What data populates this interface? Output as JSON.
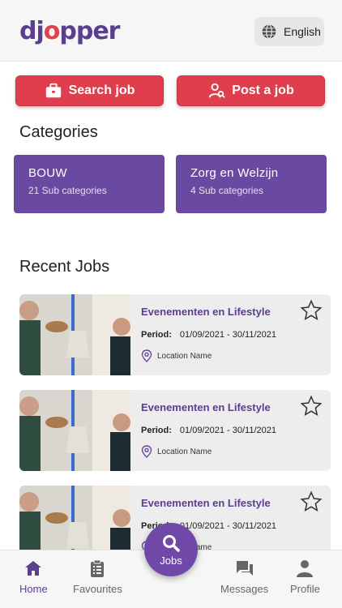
{
  "header": {
    "logo_text": "djopper",
    "language_label": "English"
  },
  "actions": {
    "search_job": "Search job",
    "post_job": "Post a job"
  },
  "categories": {
    "title": "Categories",
    "items": [
      {
        "name": "BOUW",
        "sub": "21 Sub categories"
      },
      {
        "name": "Zorg en Welzijn",
        "sub": "4 Sub categories"
      }
    ]
  },
  "recent_jobs": {
    "title": "Recent Jobs",
    "items": [
      {
        "title": "Evenementen en Lifestyle",
        "period_label": "Period:",
        "period": "01/09/2021 - 30/11/2021",
        "location": "Location Name"
      },
      {
        "title": "Evenementen en Lifestyle",
        "period_label": "Period:",
        "period": "01/09/2021 - 30/11/2021",
        "location": "Location Name"
      },
      {
        "title": "Evenementen en Lifestyle",
        "period_label": "Period:",
        "period": "01/09/2021 - 30/11/2021",
        "location": "Location Name"
      }
    ]
  },
  "nav": {
    "home": "Home",
    "favourites": "Favourites",
    "jobs": "Jobs",
    "messages": "Messages",
    "profile": "Profile"
  },
  "colors": {
    "brand_purple": "#6a4aa0",
    "brand_red": "#df3f4d"
  },
  "icons": [
    "globe-icon",
    "briefcase-icon",
    "user-tie-icon",
    "star-icon",
    "location-pin-icon",
    "home-icon",
    "clipboard-icon",
    "search-icon",
    "chat-icon",
    "user-icon"
  ]
}
